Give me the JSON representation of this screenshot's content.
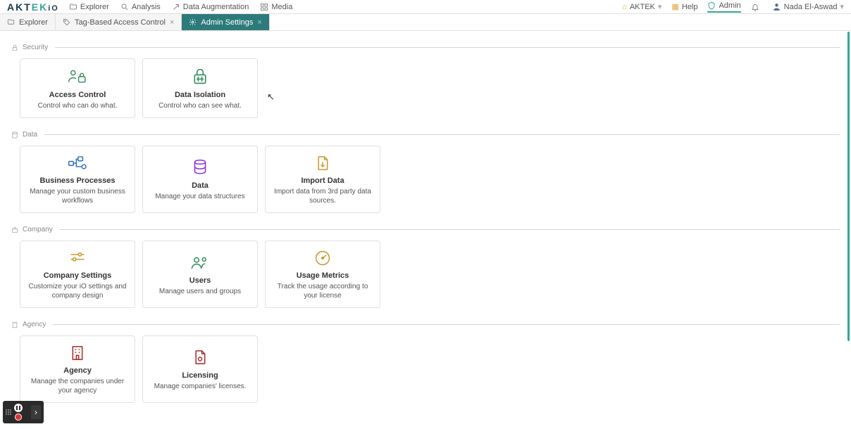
{
  "brand": {
    "part1": "AKT",
    "part2": "EK",
    "part3": "iO"
  },
  "topnav": {
    "explorer": "Explorer",
    "analysis": "Analysis",
    "augmentation": "Data Augmentation",
    "media": "Media"
  },
  "topright": {
    "org": "AKTEK",
    "help": "Help",
    "admin": "Admin",
    "user": "Nada El-Aswad"
  },
  "tabs": [
    {
      "label": "Explorer",
      "active": false,
      "closable": false
    },
    {
      "label": "Tag-Based Access Control",
      "active": false,
      "closable": true
    },
    {
      "label": "Admin Settings",
      "active": true,
      "closable": true
    }
  ],
  "sections": [
    {
      "key": "security",
      "label": "Security",
      "cards": [
        {
          "title": "Access Control",
          "desc": "Control who can do what.",
          "icon": "user-lock",
          "color": "#2e8b57"
        },
        {
          "title": "Data Isolation",
          "desc": "Control who can see what.",
          "icon": "lock-grid",
          "color": "#2e8b57"
        }
      ]
    },
    {
      "key": "data",
      "label": "Data",
      "cards": [
        {
          "title": "Business Processes",
          "desc": "Manage your custom business workflows",
          "icon": "workflow",
          "color": "#2a6fbf"
        },
        {
          "title": "Data",
          "desc": "Manage your data structures",
          "icon": "database",
          "color": "#8a2be2"
        },
        {
          "title": "Import Data",
          "desc": "Import data from 3rd party data sources.",
          "icon": "import",
          "color": "#c99a2e"
        }
      ]
    },
    {
      "key": "company",
      "label": "Company",
      "cards": [
        {
          "title": "Company Settings",
          "desc": "Customize your iO settings and company design",
          "icon": "sliders",
          "color": "#c99a2e"
        },
        {
          "title": "Users",
          "desc": "Manage users and groups",
          "icon": "users",
          "color": "#2e8b57"
        },
        {
          "title": "Usage Metrics",
          "desc": "Track the usage according to your license",
          "icon": "gauge",
          "color": "#c99a2e"
        }
      ]
    },
    {
      "key": "agency",
      "label": "Agency",
      "cards": [
        {
          "title": "Agency",
          "desc": "Manage the companies under your agency",
          "icon": "building",
          "color": "#a52a2a"
        },
        {
          "title": "Licensing",
          "desc": "Manage companies' licenses.",
          "icon": "license",
          "color": "#a52a2a"
        }
      ]
    }
  ]
}
